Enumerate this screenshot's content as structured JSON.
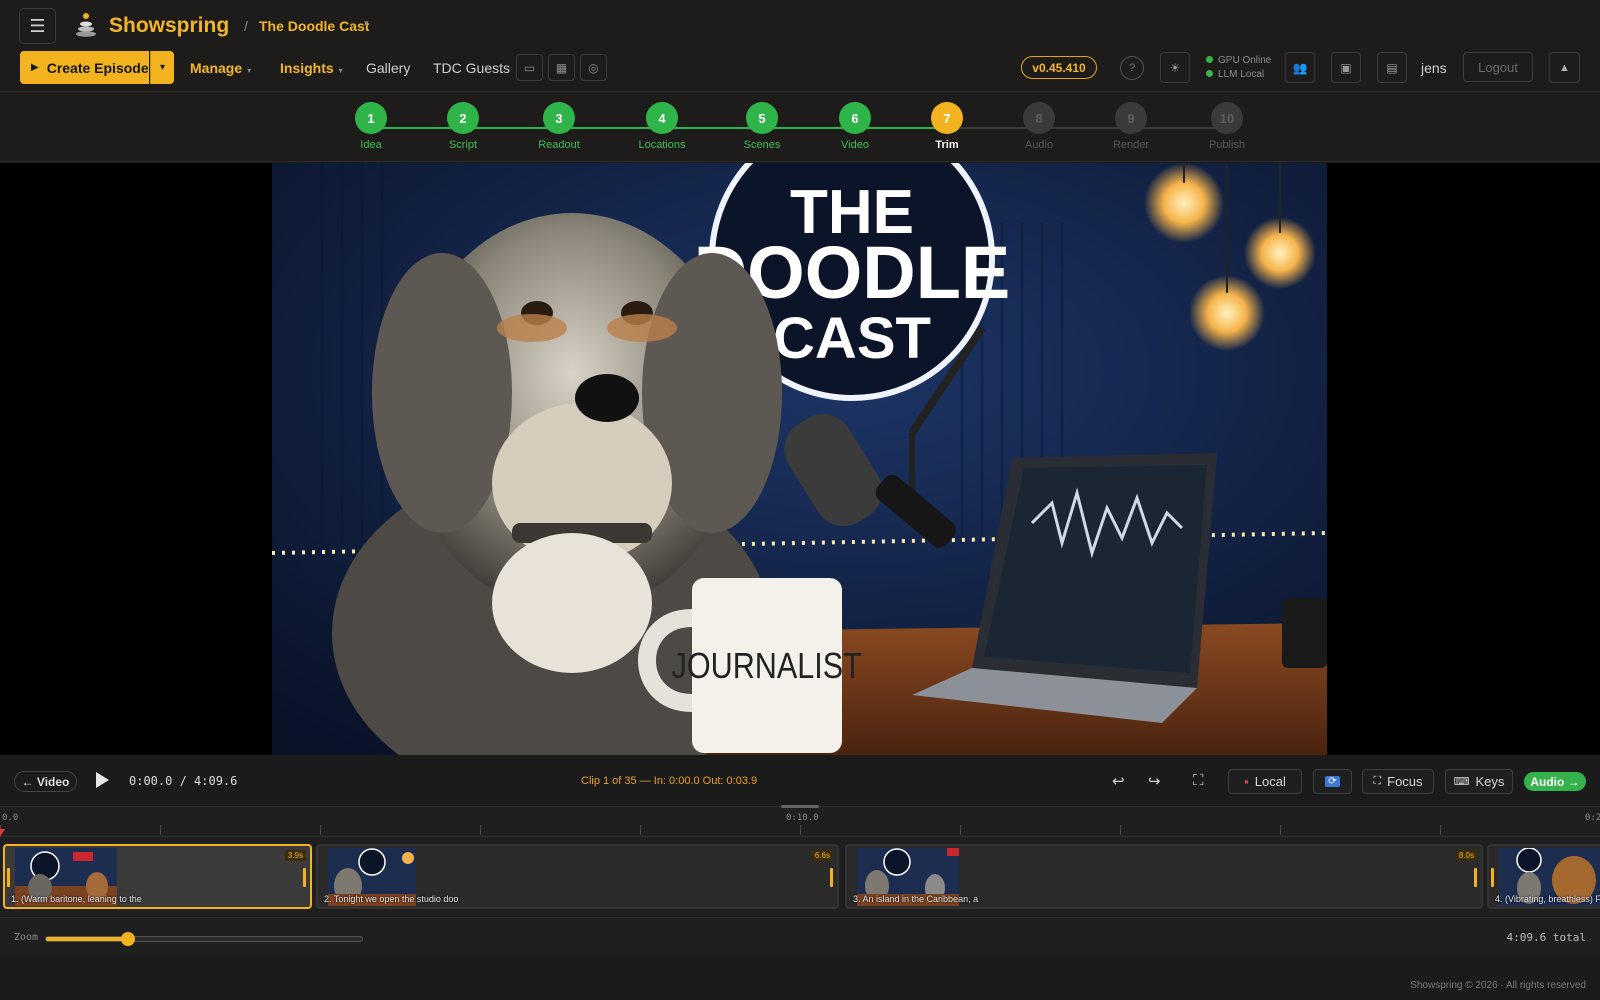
{
  "header": {
    "brand": "Showspring",
    "breadcrumb_sep": "/",
    "breadcrumb": "The Doodle Cast",
    "create_label": "Create Episode",
    "nav": [
      {
        "label": "Manage"
      },
      {
        "label": "Insights"
      },
      {
        "label": "Gallery"
      },
      {
        "label": "TDC Guests"
      }
    ],
    "version": "v0.45.410",
    "help": "?",
    "status": {
      "gpu": "GPU Online",
      "llm": "LLM Local"
    },
    "user": "jens",
    "logout": "Logout",
    "colors": {
      "accent": "#f2b31f",
      "ok": "#2fb44a"
    }
  },
  "steps": [
    {
      "num": "1",
      "label": "Idea",
      "state": "done"
    },
    {
      "num": "2",
      "label": "Script",
      "state": "done"
    },
    {
      "num": "3",
      "label": "Readout",
      "state": "done"
    },
    {
      "num": "4",
      "label": "Locations",
      "state": "done"
    },
    {
      "num": "5",
      "label": "Scenes",
      "state": "done"
    },
    {
      "num": "6",
      "label": "Video",
      "state": "done"
    },
    {
      "num": "7",
      "label": "Trim",
      "state": "current"
    },
    {
      "num": "8",
      "label": "Audio",
      "state": "todo"
    },
    {
      "num": "9",
      "label": "Render",
      "state": "todo"
    },
    {
      "num": "10",
      "label": "Publish",
      "state": "todo"
    }
  ],
  "viewer": {
    "sign_line1": "THE",
    "sign_line2": "DOODLE",
    "sign_line3": "CAST",
    "mug_text": "JOURNALIST"
  },
  "controls": {
    "back_label": "← Video",
    "timecode": "0:00.0 / 4:09.6",
    "clip_info": "Clip 1 of 35 — In: 0:00.0 Out: 0:03.9",
    "local_label": "Local",
    "focus_label": "Focus",
    "keys_label": "Keys",
    "audio_label": "Audio →"
  },
  "timeline": {
    "ruler_labels": [
      "0.0",
      "0:10.0",
      "0:2"
    ],
    "clips": [
      {
        "caption": "1. (Warm baritone, leaning to the",
        "duration": "3.9s",
        "selected": true,
        "badge": "ON AIR"
      },
      {
        "caption": "2. Tonight we open the studio doo",
        "duration": "6.6s",
        "selected": false
      },
      {
        "caption": "3. An island in the Caribbean, a",
        "duration": "8.0s",
        "selected": false,
        "badge": "ON"
      },
      {
        "caption": "4. (Vibrating, breathless) F",
        "duration": "",
        "selected": false
      }
    ],
    "zoom_label": "Zoom",
    "zoom_level": 0.26,
    "total": "4:09.6 total"
  },
  "footer": "Showspring © 2026 · All rights reserved"
}
